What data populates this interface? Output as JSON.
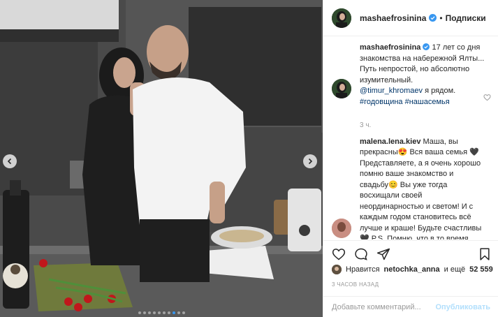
{
  "post": {
    "author": {
      "username": "mashaefrosinina",
      "verified": true,
      "follow_label": "Подписки",
      "separator": "•"
    },
    "caption": {
      "username": "mashaefrosinina",
      "text_line": "17 лет со дня знакомства на набережной Ялты... Путь непростой, но абсолютно изумительный.",
      "mention": "@timur_khromaev",
      "after_mention": " я рядом.",
      "hashtags": "#годовщина #нашасемья",
      "time": "3 ч."
    },
    "comments": [
      {
        "username": "malena.lena.kiev",
        "text": "Маша, вы прекрасны😍 Вся ваша семья 🖤 Представляете, а я очень хорошо помню ваше знакомство и свадьбу😊 Вы уже тогда восхищали своей неординарностью и светом! И с каждым годом становитесь всё лучше и краше! Будьте счастливы🖤 P.S. Помню, что в то время имя Тимур было"
      }
    ],
    "likes": {
      "prefix": "Нравится",
      "user": "netochka_anna",
      "joiner": "и ещё",
      "count": "52 559"
    },
    "time_ago": "3 ЧАСОВ НАЗАД",
    "comment_input": {
      "placeholder": "Добавьте комментарий...",
      "value": ""
    },
    "publish_label": "Опубликовать",
    "carousel": {
      "total": 10,
      "active_index": 7
    },
    "colors": {
      "accent": "#3897f0",
      "link": "#003569",
      "publish_disabled": "#b2dffc",
      "muted": "#999999"
    },
    "icons": [
      "verified-icon",
      "heart-icon",
      "comment-icon",
      "share-icon",
      "bookmark-icon",
      "chevron-left-icon",
      "chevron-right-icon",
      "like-small-icon"
    ]
  }
}
